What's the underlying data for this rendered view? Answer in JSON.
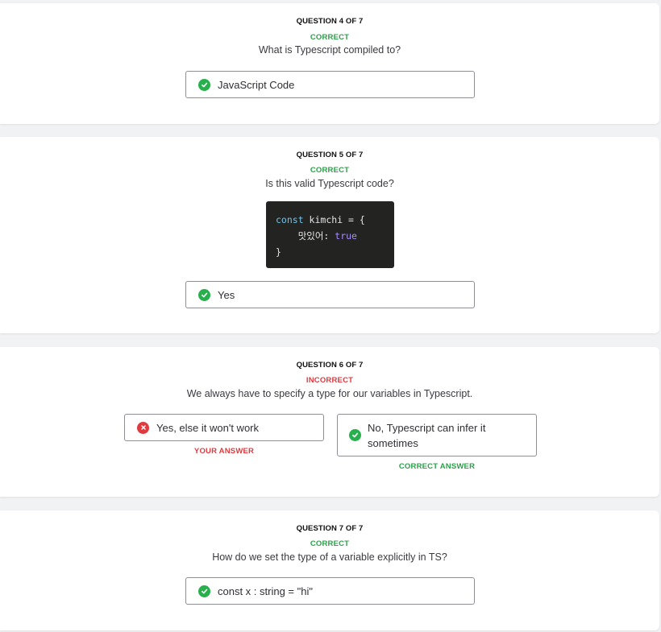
{
  "questions": [
    {
      "number_label": "QUESTION 4 OF 7",
      "status": "CORRECT",
      "text": "What is Typescript compiled to?",
      "answer": "JavaScript Code"
    },
    {
      "number_label": "QUESTION 5 OF 7",
      "status": "CORRECT",
      "text": "Is this valid Typescript code?",
      "code": {
        "line1_kw": "const",
        "line1_rest": " kimchi = {",
        "line2_key": "    맛있어: ",
        "line2_val": "true",
        "line3": "}"
      },
      "answer": "Yes"
    },
    {
      "number_label": "QUESTION 6 OF 7",
      "status": "INCORRECT",
      "text": "We always have to specify a type for our variables in Typescript.",
      "your_answer": "Yes, else it won't work",
      "your_answer_label": "YOUR ANSWER",
      "correct_answer": "No, Typescript can infer it sometimes",
      "correct_answer_label": "CORRECT ANSWER"
    },
    {
      "number_label": "QUESTION 7 OF 7",
      "status": "CORRECT",
      "text": "How do we set the type of a variable explicitly in TS?",
      "answer": "const x : string = \"hi\""
    }
  ],
  "colors": {
    "correct": "#2ca04a",
    "incorrect": "#e0393e",
    "check_icon": "#28b04d",
    "x_icon": "#e0393e"
  },
  "icons": {
    "correct": "check-circle-icon",
    "incorrect": "x-circle-icon"
  }
}
